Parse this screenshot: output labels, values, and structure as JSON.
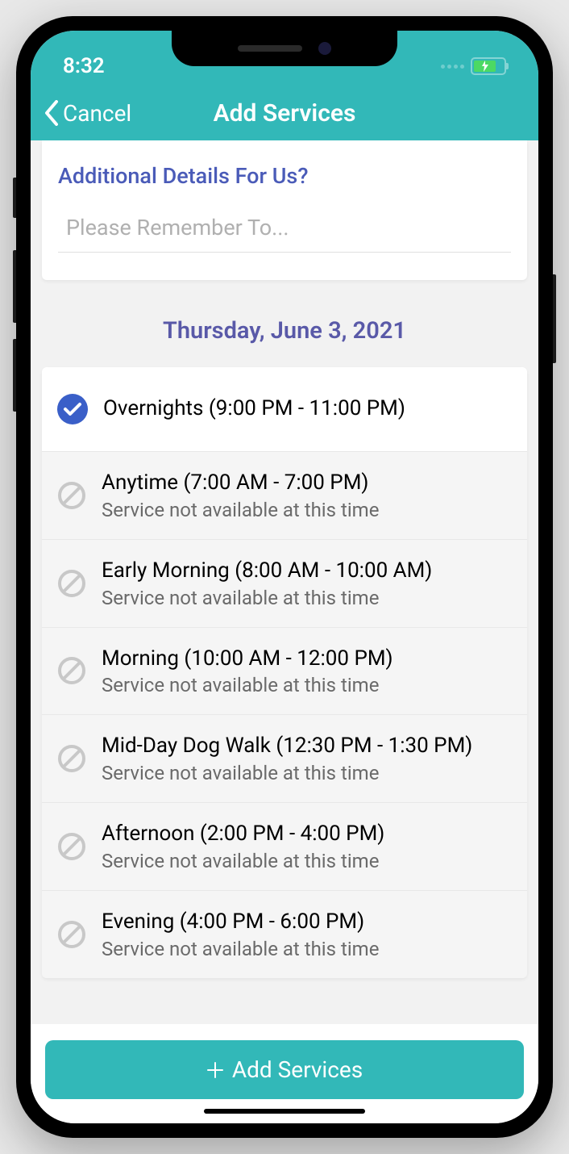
{
  "status": {
    "time": "8:32"
  },
  "nav": {
    "cancel_label": "Cancel",
    "title": "Add Services"
  },
  "details": {
    "label": "Additional Details For Us?",
    "placeholder": "Please Remember To..."
  },
  "date_header": "Thursday, June 3, 2021",
  "services": [
    {
      "title": "Overnights (9:00 PM - 11:00 PM)",
      "available": true,
      "selected": true
    },
    {
      "title": "Anytime (7:00 AM - 7:00 PM)",
      "subtitle": "Service not available at this time",
      "available": false
    },
    {
      "title": "Early Morning (8:00 AM - 10:00 AM)",
      "subtitle": "Service not available at this time",
      "available": false
    },
    {
      "title": "Morning (10:00 AM - 12:00 PM)",
      "subtitle": "Service not available at this time",
      "available": false
    },
    {
      "title": "Mid-Day Dog Walk (12:30 PM - 1:30 PM)",
      "subtitle": "Service not available at this time",
      "available": false
    },
    {
      "title": "Afternoon (2:00 PM - 4:00 PM)",
      "subtitle": "Service not available at this time",
      "available": false
    },
    {
      "title": "Evening (4:00 PM - 6:00 PM)",
      "subtitle": "Service not available at this time",
      "available": false
    }
  ],
  "footer": {
    "add_button_label": "Add Services"
  }
}
